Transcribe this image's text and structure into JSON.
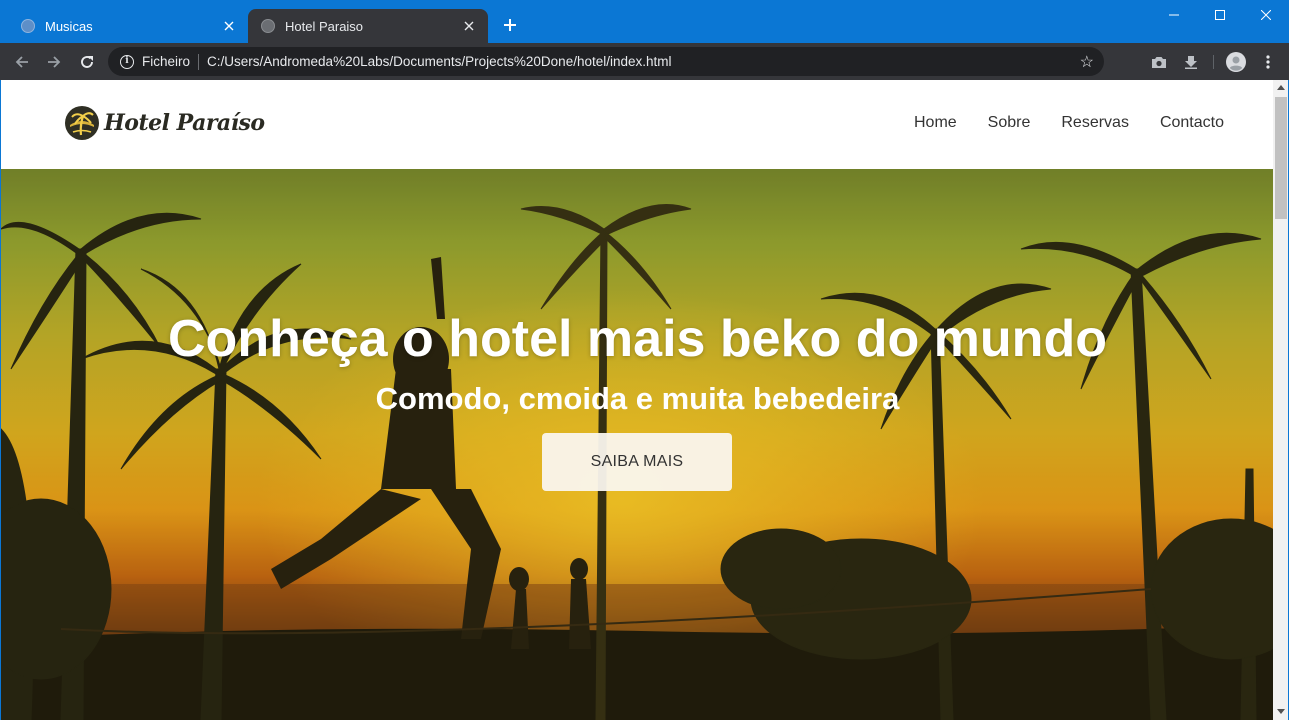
{
  "browser": {
    "tabs": [
      {
        "title": "Musicas",
        "active": false
      },
      {
        "title": "Hotel Paraiso",
        "active": true
      }
    ],
    "address": {
      "scheme_label": "Ficheiro",
      "url": "C:/Users/Andromeda%20Labs/Documents/Projects%20Done/hotel/index.html"
    },
    "icons": {
      "tab_favicon": "globe-icon",
      "close": "close-icon",
      "new_tab": "plus-icon",
      "back": "arrow-left-icon",
      "forward": "arrow-right-icon",
      "reload": "reload-icon",
      "info": "info-icon",
      "bookmark": "star-icon",
      "screenshot": "camera-icon",
      "download": "download-icon",
      "profile": "avatar-icon",
      "menu": "more-vert-icon"
    },
    "colors": {
      "titlebar": "#0b77d4",
      "toolbar": "#35363a",
      "omnibox": "#202124"
    }
  },
  "site": {
    "logo_text": "Hotel Paraíso",
    "nav": [
      "Home",
      "Sobre",
      "Reservas",
      "Contacto"
    ],
    "hero": {
      "title": "Conheça o hotel mais beko do mundo",
      "subtitle": "Comodo, cmoida e muita bebedeira",
      "cta": "SAIBA MAIS"
    }
  }
}
